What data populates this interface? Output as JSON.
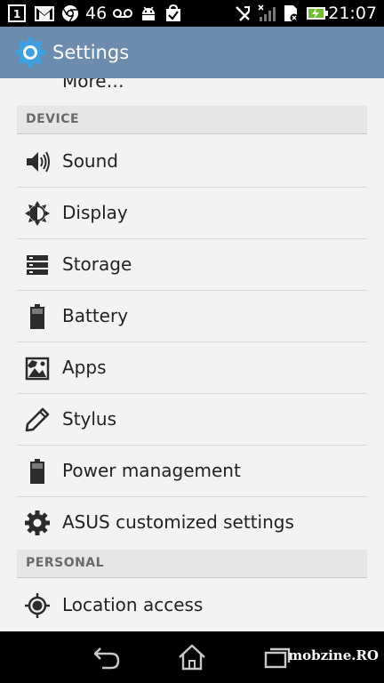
{
  "status_bar": {
    "notification_count": "1",
    "signal_label": "46",
    "clock": "21:07",
    "icons": [
      "notification-count-icon",
      "gmail-icon",
      "chrome-icon",
      "voicemail-icon",
      "android-icon",
      "task-done-icon",
      "mute-icon",
      "signal-off-icon",
      "sd-card-icon",
      "battery-charging-icon"
    ]
  },
  "action_bar": {
    "title": "Settings",
    "icon": "gear-icon"
  },
  "list": {
    "partial_item": "More…",
    "sections": [
      {
        "header": "DEVICE",
        "items": [
          {
            "label": "Sound",
            "icon": "speaker-icon"
          },
          {
            "label": "Display",
            "icon": "brightness-icon"
          },
          {
            "label": "Storage",
            "icon": "storage-icon"
          },
          {
            "label": "Battery",
            "icon": "battery-icon"
          },
          {
            "label": "Apps",
            "icon": "apps-icon"
          },
          {
            "label": "Stylus",
            "icon": "pen-icon"
          },
          {
            "label": "Power management",
            "icon": "battery-icon"
          },
          {
            "label": "ASUS customized settings",
            "icon": "gear-icon"
          }
        ]
      },
      {
        "header": "PERSONAL",
        "items": [
          {
            "label": "Location access",
            "icon": "location-icon"
          }
        ]
      }
    ]
  },
  "nav_bar": {
    "buttons": [
      "back-icon",
      "home-icon",
      "recent-apps-icon"
    ],
    "watermark": "mobzine.RO"
  },
  "colors": {
    "action_bar": "#6d8cad",
    "list_background": "#f3f3f3",
    "section_header": "#e6e6e6",
    "status_bar": "#000000"
  }
}
